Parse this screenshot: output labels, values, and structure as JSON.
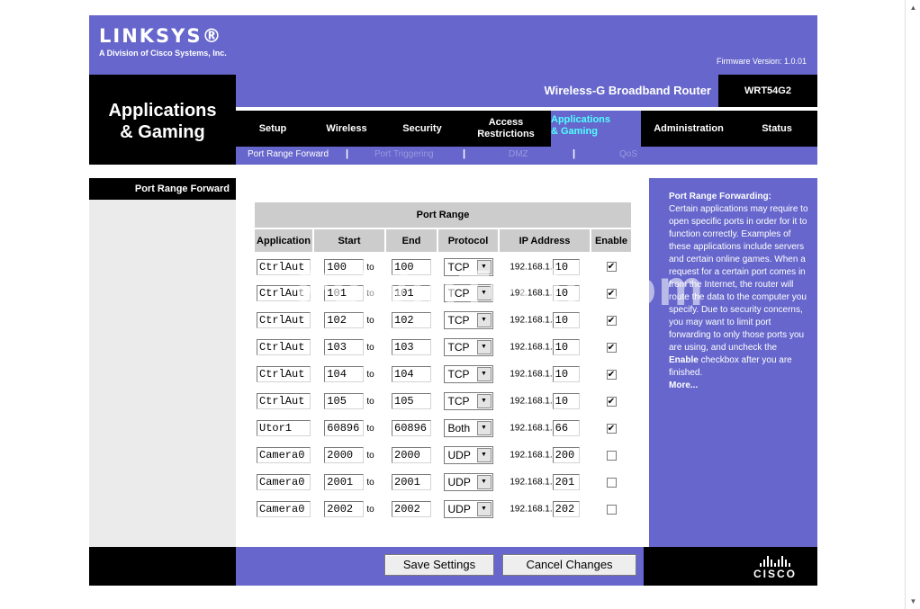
{
  "brand": {
    "logo": "LINKSYS®",
    "subtitle": "A Division of Cisco Systems, Inc.",
    "firmware": "Firmware Version: 1.0.01",
    "product_name": "Wireless-G Broadband Router",
    "model": "WRT54G2",
    "footer_logo": "CISCO"
  },
  "section": {
    "title_line1": "Applications",
    "title_line2": "& Gaming"
  },
  "nav": {
    "tabs": [
      {
        "label": "Setup"
      },
      {
        "label": "Wireless"
      },
      {
        "label": "Security"
      },
      {
        "label_line1": "Access",
        "label_line2": "Restrictions"
      },
      {
        "label_line1": "Applications",
        "label_line2": "& Gaming",
        "active": true
      },
      {
        "label": "Administration"
      },
      {
        "label": "Status"
      }
    ],
    "subtabs": [
      {
        "label": "Port Range Forward",
        "active": true
      },
      {
        "label": "Port Triggering"
      },
      {
        "label": "DMZ"
      },
      {
        "label": "QoS"
      }
    ],
    "separator": "|"
  },
  "left_label": "Port Range Forward",
  "table": {
    "title": "Port Range",
    "headers": [
      "Application",
      "Start",
      "End",
      "Protocol",
      "IP Address",
      "Enable"
    ],
    "to_label": "to",
    "ip_prefix": "192.168.1.",
    "rows": [
      {
        "app": "CtrlAut",
        "start": "100",
        "end": "100",
        "protocol": "TCP",
        "ip": "10",
        "enabled": true
      },
      {
        "app": "CtrlAut",
        "start": "101",
        "end": "101",
        "protocol": "TCP",
        "ip": "10",
        "enabled": true
      },
      {
        "app": "CtrlAut",
        "start": "102",
        "end": "102",
        "protocol": "TCP",
        "ip": "10",
        "enabled": true
      },
      {
        "app": "CtrlAut",
        "start": "103",
        "end": "103",
        "protocol": "TCP",
        "ip": "10",
        "enabled": true
      },
      {
        "app": "CtrlAut",
        "start": "104",
        "end": "104",
        "protocol": "TCP",
        "ip": "10",
        "enabled": true
      },
      {
        "app": "CtrlAut",
        "start": "105",
        "end": "105",
        "protocol": "TCP",
        "ip": "10",
        "enabled": true
      },
      {
        "app": "Utor1",
        "start": "60896",
        "end": "60896",
        "protocol": "Both",
        "ip": "66",
        "enabled": true
      },
      {
        "app": "Camera0",
        "start": "2000",
        "end": "2000",
        "protocol": "UDP",
        "ip": "200",
        "enabled": false
      },
      {
        "app": "Camera0",
        "start": "2001",
        "end": "2001",
        "protocol": "UDP",
        "ip": "201",
        "enabled": false
      },
      {
        "app": "Camera0",
        "start": "2002",
        "end": "2002",
        "protocol": "UDP",
        "ip": "202",
        "enabled": false
      }
    ]
  },
  "help": {
    "title": "Port Range Forwarding:",
    "body_before": "Certain applications may require to open specific ports in order for it to function correctly. Examples of these applications include servers and certain online games. When a request for a certain port comes in from the Internet, the router will route the data to the computer you specify. Due to security concerns, you may want to limit port forwarding to only those ports you are using, and uncheck the ",
    "body_bold": "Enable",
    "body_after": " checkbox after you are finished.",
    "more": "More..."
  },
  "buttons": {
    "save": "Save Settings",
    "cancel": "Cancel Changes"
  },
  "watermark": "PcWinTech.com",
  "colors": {
    "purple": "#6666cc",
    "black": "#000000",
    "active_tab_text": "#52ffff",
    "grey_panel": "#ebebeb"
  }
}
